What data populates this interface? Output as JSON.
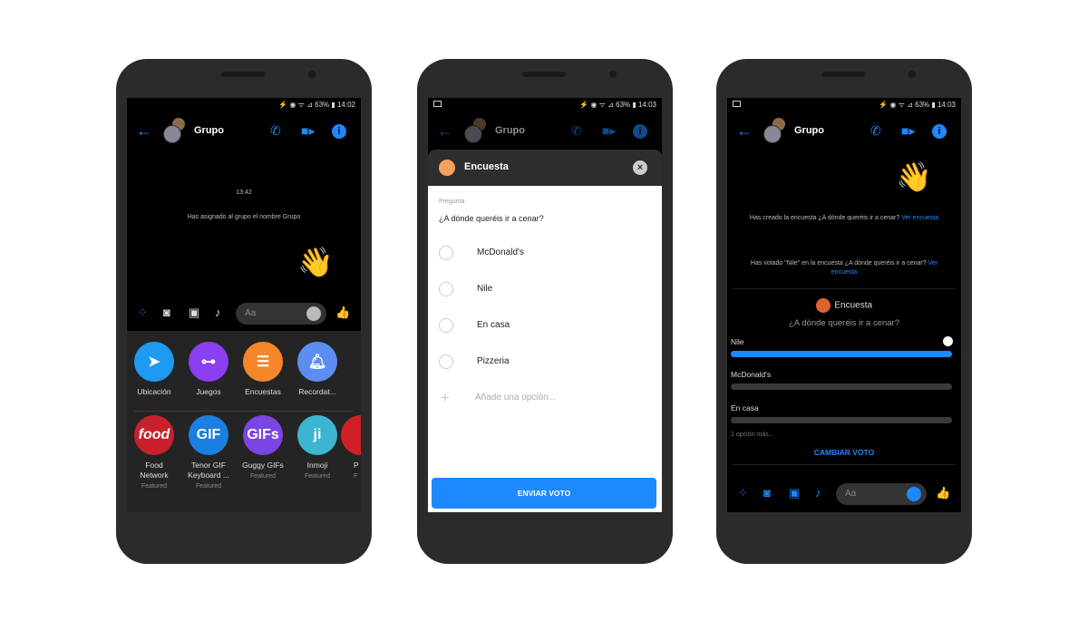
{
  "phone1": {
    "status": "⚡ ◉ ᯤ ⊿ 63% ▮ 14:02",
    "title": "Grupo",
    "timestamp": "13:42",
    "system_message": "Has asignado al grupo el nombre Grupo",
    "composer_placeholder": "Aa",
    "actions": [
      {
        "label": "Ubicación",
        "color": "#1e9bf0",
        "icon": "location-arrow"
      },
      {
        "label": "Juegos",
        "color": "#8b3ff0",
        "icon": "gamepad"
      },
      {
        "label": "Encuestas",
        "color": "#f5862a",
        "icon": "poll"
      },
      {
        "label": "Recordat...",
        "color": "#5b8ef0",
        "icon": "bell"
      }
    ],
    "apps": [
      {
        "name_1": "Food",
        "name_2": "Network",
        "sub": "Featured",
        "logo": "food",
        "color": "#c8202c"
      },
      {
        "name_1": "Tenor GIF",
        "name_2": "Keyboard ...",
        "sub": "Featured",
        "logo": "GIF",
        "color": "#1a7fe0"
      },
      {
        "name_1": "Guggy GIFs",
        "name_2": "",
        "sub": "Featured",
        "logo": "GIFs",
        "color": "#7a45e0"
      },
      {
        "name_1": "Inmoji",
        "name_2": "",
        "sub": "Featured",
        "logo": "ji",
        "color": "#3cb6d0"
      },
      {
        "name_1": "P",
        "name_2": "",
        "sub": "F",
        "logo": "",
        "color": "#d0202a"
      }
    ]
  },
  "phone2": {
    "status": "⚡ ◉ ᯤ ⊿ 63% ▮ 14:03",
    "title": "Grupo",
    "sheet_title": "Encuesta",
    "question_label": "Pregunta",
    "question": "¿A dónde queréis ir a cenar?",
    "options": [
      "McDonald's",
      "Nile",
      "En casa",
      "Pizzeria"
    ],
    "add_option_placeholder": "Añade una opción...",
    "submit": "ENVIAR VOTO"
  },
  "phone3": {
    "status": "⚡ ◉ ᯤ ⊿ 63% ▮ 14:03",
    "title": "Grupo",
    "msg1": "Has creado la encuesta ¿A dónde queréis ir a cenar?",
    "msg1_link": "Ver encuesta",
    "msg2": "Has votado \"Nile\" en la encuesta ¿A dónde queréis ir a cenar?",
    "msg2_link": "Ver encuesta",
    "poll_title": "Encuesta",
    "poll_question": "¿A dónde queréis ir a cenar?",
    "results": [
      {
        "label": "Nile",
        "fill": 1.0,
        "selected": true
      },
      {
        "label": "McDonald's",
        "fill": 0,
        "selected": false
      },
      {
        "label": "En casa",
        "fill": 0,
        "selected": false
      }
    ],
    "more": "1 opción más...",
    "change_vote": "CAMBIAR VOTO",
    "composer_placeholder": "Aa"
  },
  "colors": {
    "accent": "#1e88ff",
    "poll": "#f5862a"
  }
}
